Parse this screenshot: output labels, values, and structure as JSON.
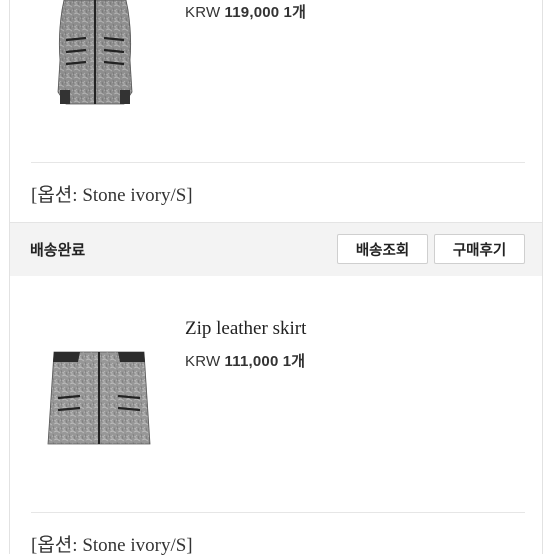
{
  "orders": [
    {
      "image_icon": "leather-vest-product-image",
      "name": "",
      "price": {
        "currency": "KRW",
        "amount": "119,000",
        "quantity": "1개"
      },
      "option": "[옵션: Stone ivory/S]"
    },
    {
      "image_icon": "leather-skirt-product-image",
      "name": "Zip leather skirt",
      "price": {
        "currency": "KRW",
        "amount": "111,000",
        "quantity": "1개"
      },
      "option": "[옵션: Stone ivory/S]"
    }
  ],
  "delivery": {
    "status": "배송완료",
    "track_button": "배송조회",
    "review_button": "구매후기"
  },
  "colors": {
    "status_bar_bg": "#f3f3f3",
    "divider": "#e6e6e6",
    "text": "#222222"
  }
}
